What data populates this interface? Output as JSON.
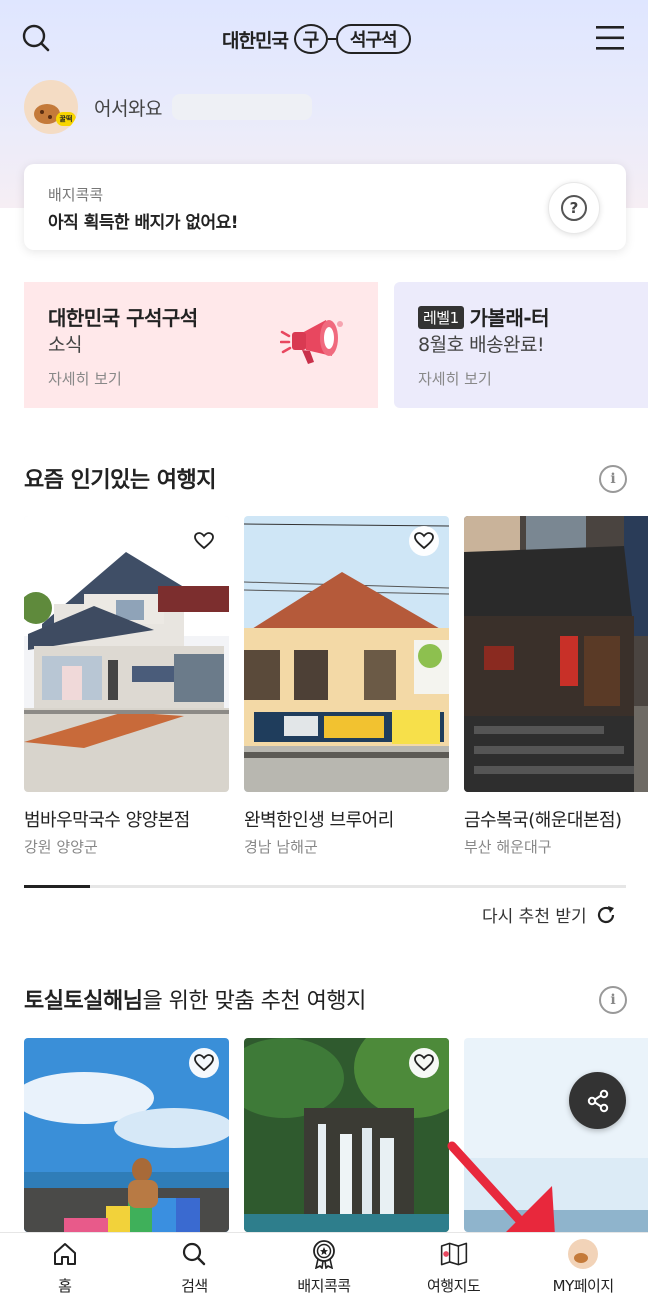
{
  "header": {
    "logo": {
      "part1": "대한민국",
      "circle": "구",
      "pill": "석구석"
    }
  },
  "welcome": {
    "greeting": "어서와요",
    "avatar_badge": "꿀떡"
  },
  "badge_card": {
    "label": "배지콕콕",
    "message": "아직 획득한 배지가 없어요!",
    "help": "?"
  },
  "banners": [
    {
      "title": "대한민국 구석구석",
      "subtitle": "소식",
      "more": "자세히 보기"
    },
    {
      "tag": "레벨1",
      "title": "가볼래-터",
      "subtitle": "8월호 배송완료!",
      "more": "자세히 보기"
    }
  ],
  "popular": {
    "title": "요즘 인기있는 여행지",
    "info": "i",
    "progress_fraction": 0.11,
    "cards": [
      {
        "name": "범바우막국수 양양본점",
        "region": "강원 양양군"
      },
      {
        "name": "완벽한인생 브루어리",
        "region": "경남 남해군"
      },
      {
        "name": "금수복국(해운대본점)",
        "region": "부산 해운대구"
      }
    ],
    "refresh_label": "다시 추천 받기"
  },
  "recommend": {
    "title_bold": "토실토실해님",
    "title_rest": "을 위한 맞춤 추천 여행지",
    "info": "i"
  },
  "bottom_nav": [
    {
      "label": "홈",
      "icon": "home-icon"
    },
    {
      "label": "검색",
      "icon": "search-icon"
    },
    {
      "label": "배지콕콕",
      "icon": "badge-icon"
    },
    {
      "label": "여행지도",
      "icon": "map-icon"
    },
    {
      "label": "MY페이지",
      "icon": "avatar-icon"
    }
  ],
  "colors": {
    "banner1_bg": "#ffe8ea",
    "banner2_bg": "#ecebfb",
    "arrow": "#e8283c",
    "megaphone": "#e8475f"
  }
}
